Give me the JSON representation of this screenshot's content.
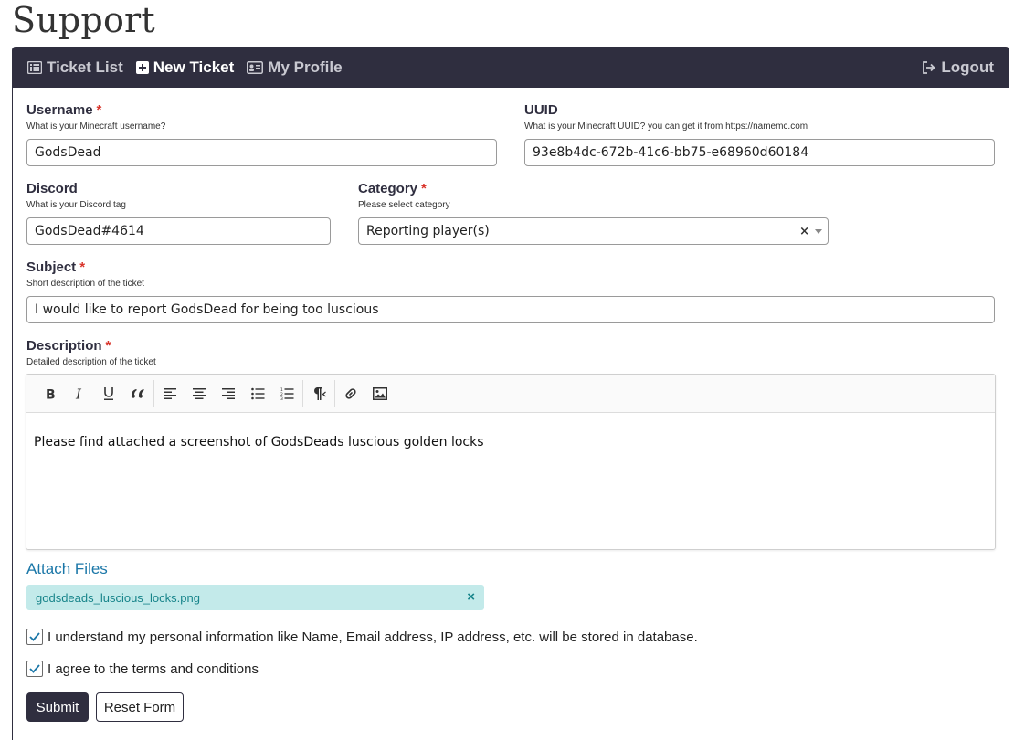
{
  "page": {
    "title": "Support"
  },
  "nav": {
    "ticket_list": "Ticket List",
    "new_ticket": "New Ticket",
    "my_profile": "My Profile",
    "logout": "Logout"
  },
  "form": {
    "username": {
      "label": "Username",
      "hint": "What is your Minecraft username?",
      "value": "GodsDead",
      "required": "*"
    },
    "uuid": {
      "label": "UUID",
      "hint": "What is your Minecraft UUID? you can get it from https://namemc.com",
      "value": "93e8b4dc-672b-41c6-bb75-e68960d60184"
    },
    "discord": {
      "label": "Discord",
      "hint": "What is your Discord tag",
      "value": "GodsDead#4614"
    },
    "category": {
      "label": "Category",
      "hint": "Please select category",
      "value": "Reporting player(s)",
      "required": "*",
      "clear": "×"
    },
    "subject": {
      "label": "Subject",
      "hint": "Short description of the ticket",
      "value": "I would like to report GodsDead for being too luscious",
      "required": "*"
    },
    "description": {
      "label": "Description",
      "hint": "Detailed description of the ticket",
      "value": "Please find attached a screenshot of GodsDeads luscious golden locks",
      "required": "*"
    },
    "attach": {
      "label": "Attach Files",
      "file_name": "godsdeads_luscious_locks.png",
      "remove": "×"
    },
    "consent_privacy": {
      "label": "I understand my personal information like Name, Email address, IP address, etc. will be stored in database.",
      "checked": true
    },
    "consent_terms": {
      "label": "I agree to the terms and conditions",
      "checked": true
    },
    "submit_label": "Submit",
    "reset_label": "Reset Form"
  },
  "colors": {
    "navbar": "#2f2e3f",
    "required": "#d9342b",
    "link": "#1b77a8",
    "chip_bg": "#c3eaea",
    "chip_text": "#17848a"
  }
}
